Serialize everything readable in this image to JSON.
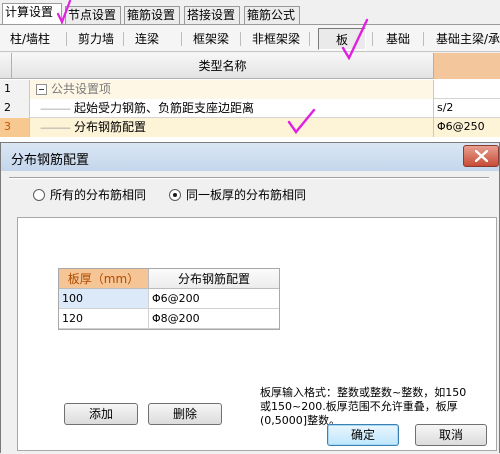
{
  "top_tabs": [
    "计算设置",
    "节点设置",
    "箍筋设置",
    "搭接设置",
    "箍筋公式"
  ],
  "sub_tabs": [
    "柱/墙柱",
    "剪力墙",
    "连梁",
    "框架梁",
    "非框架梁",
    "板",
    "基础",
    "基础主梁/承"
  ],
  "grid": {
    "header_name": "类型名称",
    "rows": [
      {
        "num": "1",
        "name": "公共设置项",
        "value": ""
      },
      {
        "num": "2",
        "name": "起始受力钢筋、负筋距支座边距离",
        "value": "s/2"
      },
      {
        "num": "3",
        "name": "分布钢筋配置",
        "value": "Φ6@250"
      }
    ]
  },
  "dialog": {
    "title": "分布钢筋配置",
    "radio_all": "所有的分布筋相同",
    "radio_same_thickness": "同一板厚的分布筋相同",
    "table": {
      "columns": [
        "板厚（mm）",
        "分布钢筋配置"
      ],
      "rows": [
        {
          "thickness": "100",
          "config": "Φ6@200"
        },
        {
          "thickness": "120",
          "config": "Φ8@200"
        }
      ]
    },
    "add_label": "添加",
    "delete_label": "删除",
    "hint": "板厚输入格式：整数或整数~整数，如150\n或150~200.板厚范围不允许重叠，板厚\n(0,5000]整数。",
    "ok_label": "确定",
    "cancel_label": "取消"
  },
  "colors": {
    "accent_orange": "#f6c595",
    "annotation_magenta": "#e020e0",
    "title_bar": "#c4d6ec"
  }
}
